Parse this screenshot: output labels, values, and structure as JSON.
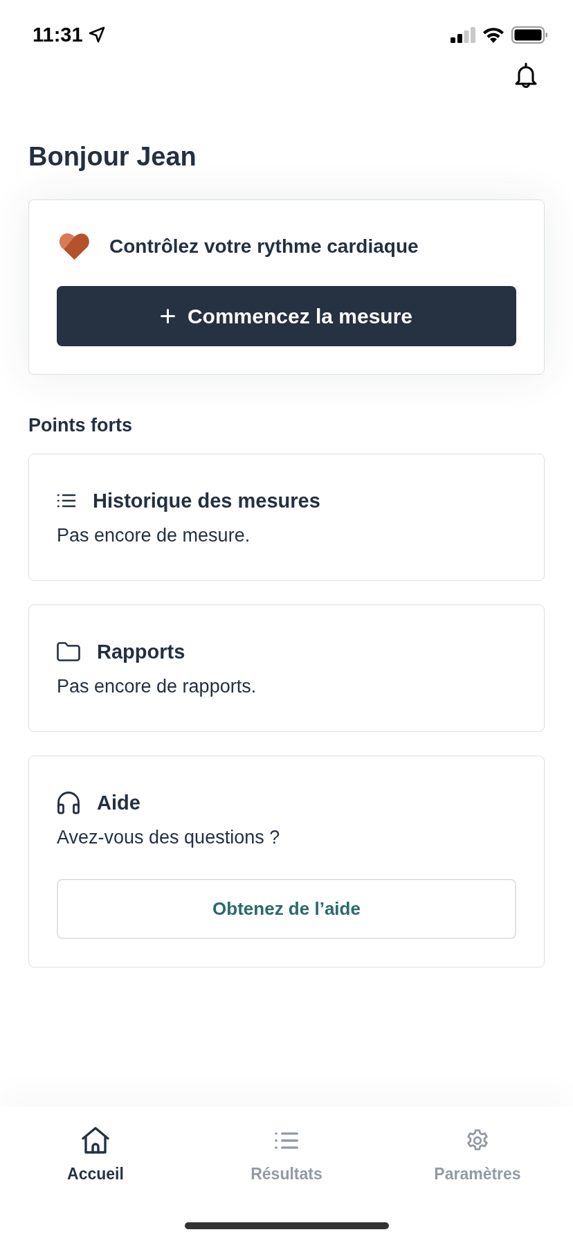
{
  "status_bar": {
    "time": "11:31"
  },
  "greeting": "Bonjour Jean",
  "heart_card": {
    "title": "Contrôlez votre rythme cardiaque",
    "button": "Commencez la mesure"
  },
  "section_title": "Points forts",
  "cards": [
    {
      "kind": "history",
      "title": "Historique des mesures",
      "text": "Pas encore de mesure."
    },
    {
      "kind": "reports",
      "title": "Rapports",
      "text": "Pas encore de rapports."
    },
    {
      "kind": "help",
      "title": "Aide",
      "text": "Avez-vous des questions ?",
      "button": "Obtenez de l’aide"
    }
  ],
  "tab_bar": [
    {
      "kind": "home",
      "label": "Accueil",
      "selected": true
    },
    {
      "kind": "results",
      "label": "Résultats",
      "selected": false
    },
    {
      "kind": "settings",
      "label": "Paramètres",
      "selected": false
    }
  ]
}
